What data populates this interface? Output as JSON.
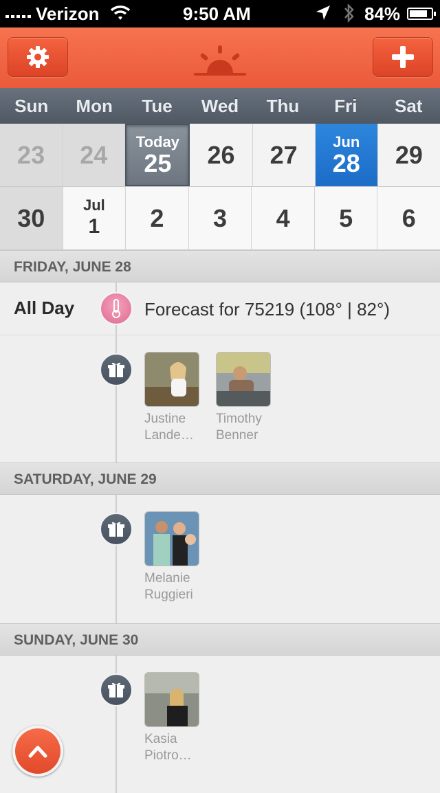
{
  "status_bar": {
    "carrier": "Verizon",
    "time": "9:50 AM",
    "battery": "84%",
    "battery_level": 0.84
  },
  "header": {
    "settings_icon": "gear-icon",
    "logo_icon": "sunrise-logo",
    "add_icon": "plus-icon",
    "accent_color": "#ef5f3e"
  },
  "weekdays": [
    "Sun",
    "Mon",
    "Tue",
    "Wed",
    "Thu",
    "Fri",
    "Sat"
  ],
  "calendar": {
    "row1": [
      {
        "day": "23",
        "state": "past"
      },
      {
        "day": "24",
        "state": "past"
      },
      {
        "top": "Today",
        "day": "25",
        "state": "today"
      },
      {
        "day": "26",
        "state": "normal"
      },
      {
        "day": "27",
        "state": "normal"
      },
      {
        "top": "Jun",
        "day": "28",
        "state": "selected"
      },
      {
        "day": "29",
        "state": "normal"
      }
    ],
    "row2": [
      {
        "day": "30",
        "state": "normal"
      },
      {
        "top": "Jul",
        "day": "1",
        "state": "month"
      },
      {
        "day": "2",
        "state": "normal"
      },
      {
        "day": "3",
        "state": "normal"
      },
      {
        "day": "4",
        "state": "normal"
      },
      {
        "day": "5",
        "state": "normal"
      },
      {
        "day": "6",
        "state": "normal"
      }
    ],
    "selected_color": "#1f72cf"
  },
  "sections": [
    {
      "heading": "FRIDAY, JUNE 28",
      "all_day_label": "All Day",
      "forecast": "Forecast for 75219 (108° | 82°)",
      "birthdays": [
        {
          "name_line1": "Justine",
          "name_line2": "Lande…"
        },
        {
          "name_line1": "Timothy",
          "name_line2": "Benner"
        }
      ]
    },
    {
      "heading": "SATURDAY, JUNE 29",
      "birthdays": [
        {
          "name_line1": "Melanie",
          "name_line2": "Ruggieri"
        }
      ]
    },
    {
      "heading": "SUNDAY, JUNE 30",
      "birthdays": [
        {
          "name_line1": "Kasia",
          "name_line2": "Piotro…"
        }
      ]
    }
  ]
}
